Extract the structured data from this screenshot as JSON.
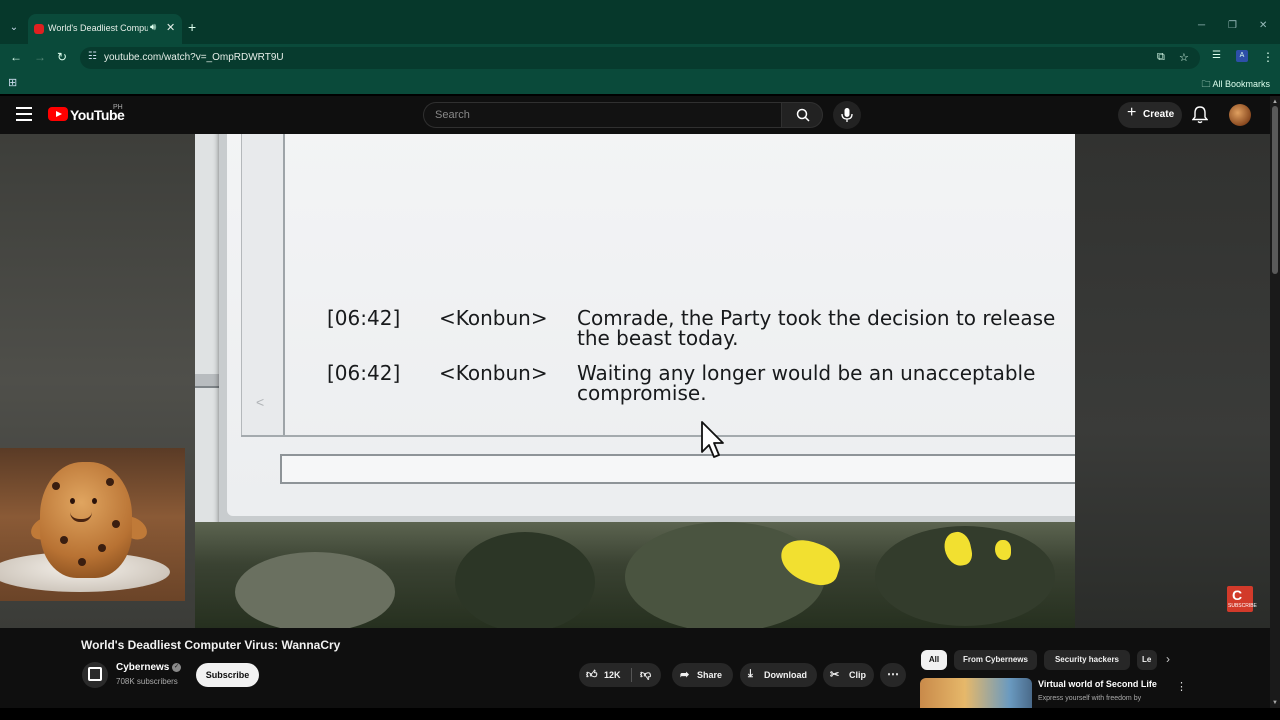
{
  "browser": {
    "tab_title": "World's Deadliest Computer Virus: WannaCry",
    "url": "youtube.com/watch?v=_OmpRDWRT9U",
    "bookmarks_label": "All Bookmarks",
    "tab_color": "#0a4a3a",
    "frame_color": "#06382b"
  },
  "youtube": {
    "logo_text": "YouTube",
    "region": "PH",
    "search_placeholder": "Search",
    "create_label": "Create",
    "brand_color": "#ff0000"
  },
  "chat": {
    "lines": [
      {
        "time": "[06:42]",
        "nick": "<Konbun>",
        "message": "Comrade, the Party took the decision to release the beast today."
      },
      {
        "time": "[06:42]",
        "nick": "<Konbun>",
        "message": "Waiting any longer would be an unacceptable compromise."
      }
    ]
  },
  "video": {
    "title": "World's Deadliest Computer Virus: WannaCry",
    "channel": "Cybernews",
    "subscribers": "708K subscribers",
    "subscribe_label": "Subscribe",
    "likes": "12K",
    "share_label": "Share",
    "download_label": "Download",
    "clip_label": "Clip",
    "watermark_text": "SUBSCRIBE"
  },
  "filters": {
    "chips": [
      "All",
      "From Cybernews",
      "Security hackers",
      "Le"
    ]
  },
  "recommendation": {
    "title": "Virtual world of Second Life",
    "description": "Express yourself with freedom by"
  }
}
